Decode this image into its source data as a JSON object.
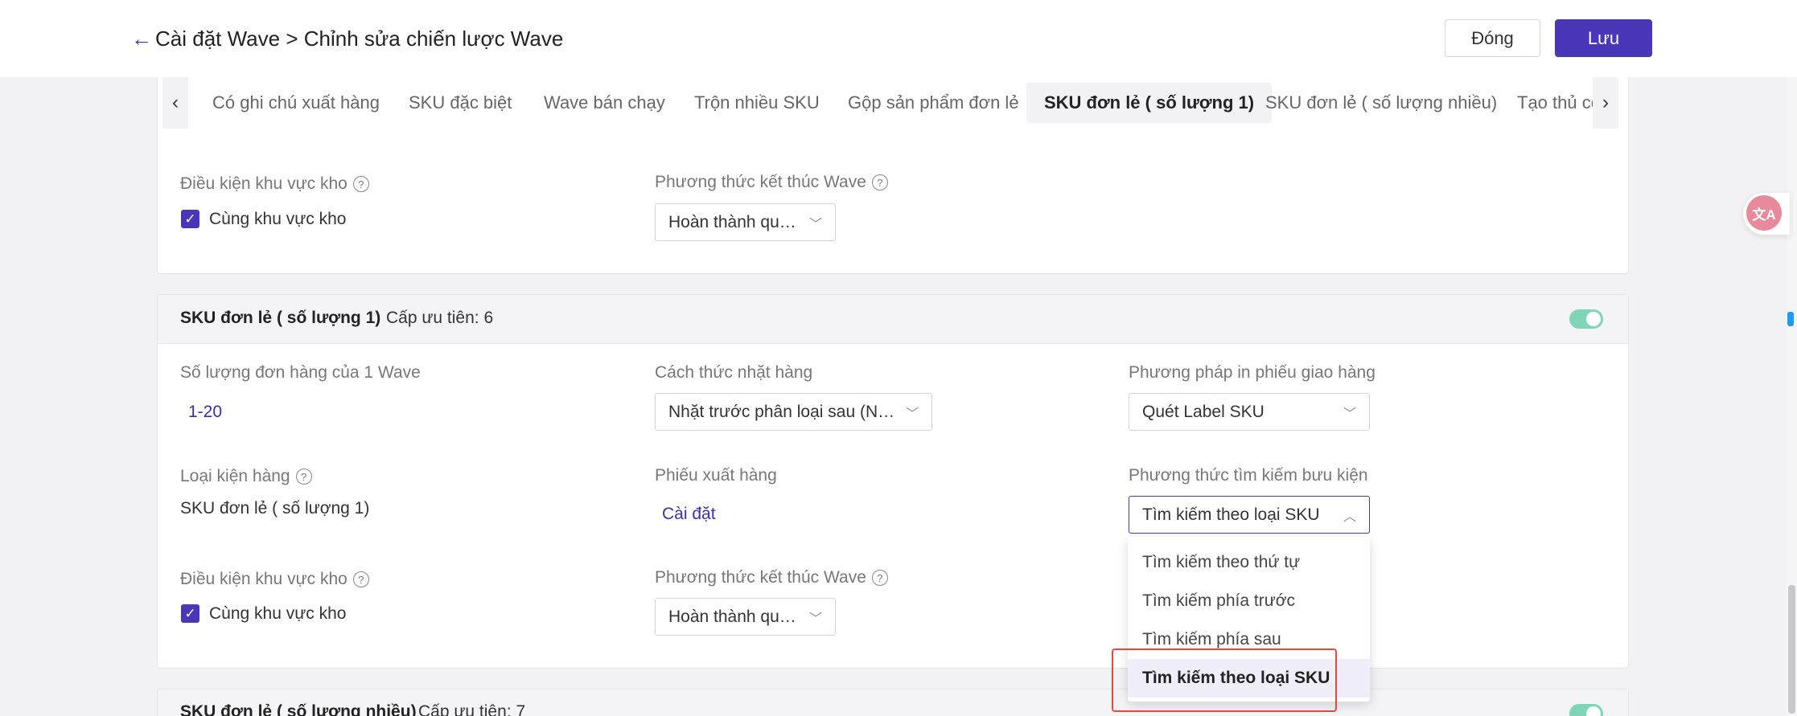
{
  "header": {
    "back_arrow": "←",
    "title": "Cài đặt Wave > Chỉnh sửa chiến lược Wave",
    "close_label": "Đóng",
    "save_label": "Lưu"
  },
  "tabs": {
    "prev": "‹",
    "next": "›",
    "items": [
      "Có ghi chú xuất hàng",
      "SKU đặc biệt",
      "Wave bán chạy",
      "Trộn nhiều SKU",
      "Gộp sản phẩm đơn lẻ",
      "SKU đơn lẻ ( số lượng 1)",
      "SKU đơn lẻ ( số lượng nhiều)",
      "Tạo thủ cô"
    ],
    "active_index": 5
  },
  "card_top": {
    "warehouse_condition_label": "Điều kiện khu vực kho",
    "warehouse_checkbox_label": "Cùng khu vực kho",
    "end_method_label": "Phương thức kết thúc Wave",
    "end_method_value": "Hoàn thành quét..."
  },
  "card_main": {
    "name": "SKU đơn lẻ ( số lượng 1)",
    "priority": "Cấp ưu tiên: 6",
    "order_count_label": "Số lượng đơn hàng của 1 Wave",
    "order_count_value": "1-20",
    "picking_label": "Cách thức nhặt hàng",
    "picking_value": "Nhặt trước phân loại sau (Nhâ...",
    "print_label": "Phương pháp in phiếu giao hàng",
    "print_value": "Quét Label SKU",
    "package_type_label": "Loại kiện hàng",
    "package_type_value": "SKU đơn lẻ ( số lượng 1)",
    "slip_label": "Phiếu xuất hàng",
    "slip_link": "Cài đặt",
    "search_label": "Phương thức tìm kiếm bưu kiện",
    "search_value": "Tìm kiếm theo loại SKU",
    "warehouse_condition_label": "Điều kiện khu vực kho",
    "warehouse_checkbox_label": "Cùng khu vực kho",
    "end_method_label": "Phương thức kết thúc Wave",
    "end_method_value": "Hoàn thành quét..."
  },
  "search_dropdown": {
    "options": [
      "Tìm kiếm theo thứ tự",
      "Tìm kiếm phía trước",
      "Tìm kiếm phía sau",
      "Tìm kiếm theo loại SKU"
    ],
    "selected_index": 3
  },
  "card_next": {
    "name": "SKU đơn lẻ ( số lượng nhiều)",
    "priority": "Cấp ưu tiên: 7"
  },
  "translate_icon": "文A",
  "colors": {
    "accent": "#4a36b8",
    "toggle_on": "#7fd6b7",
    "highlight": "#e24c3b"
  }
}
